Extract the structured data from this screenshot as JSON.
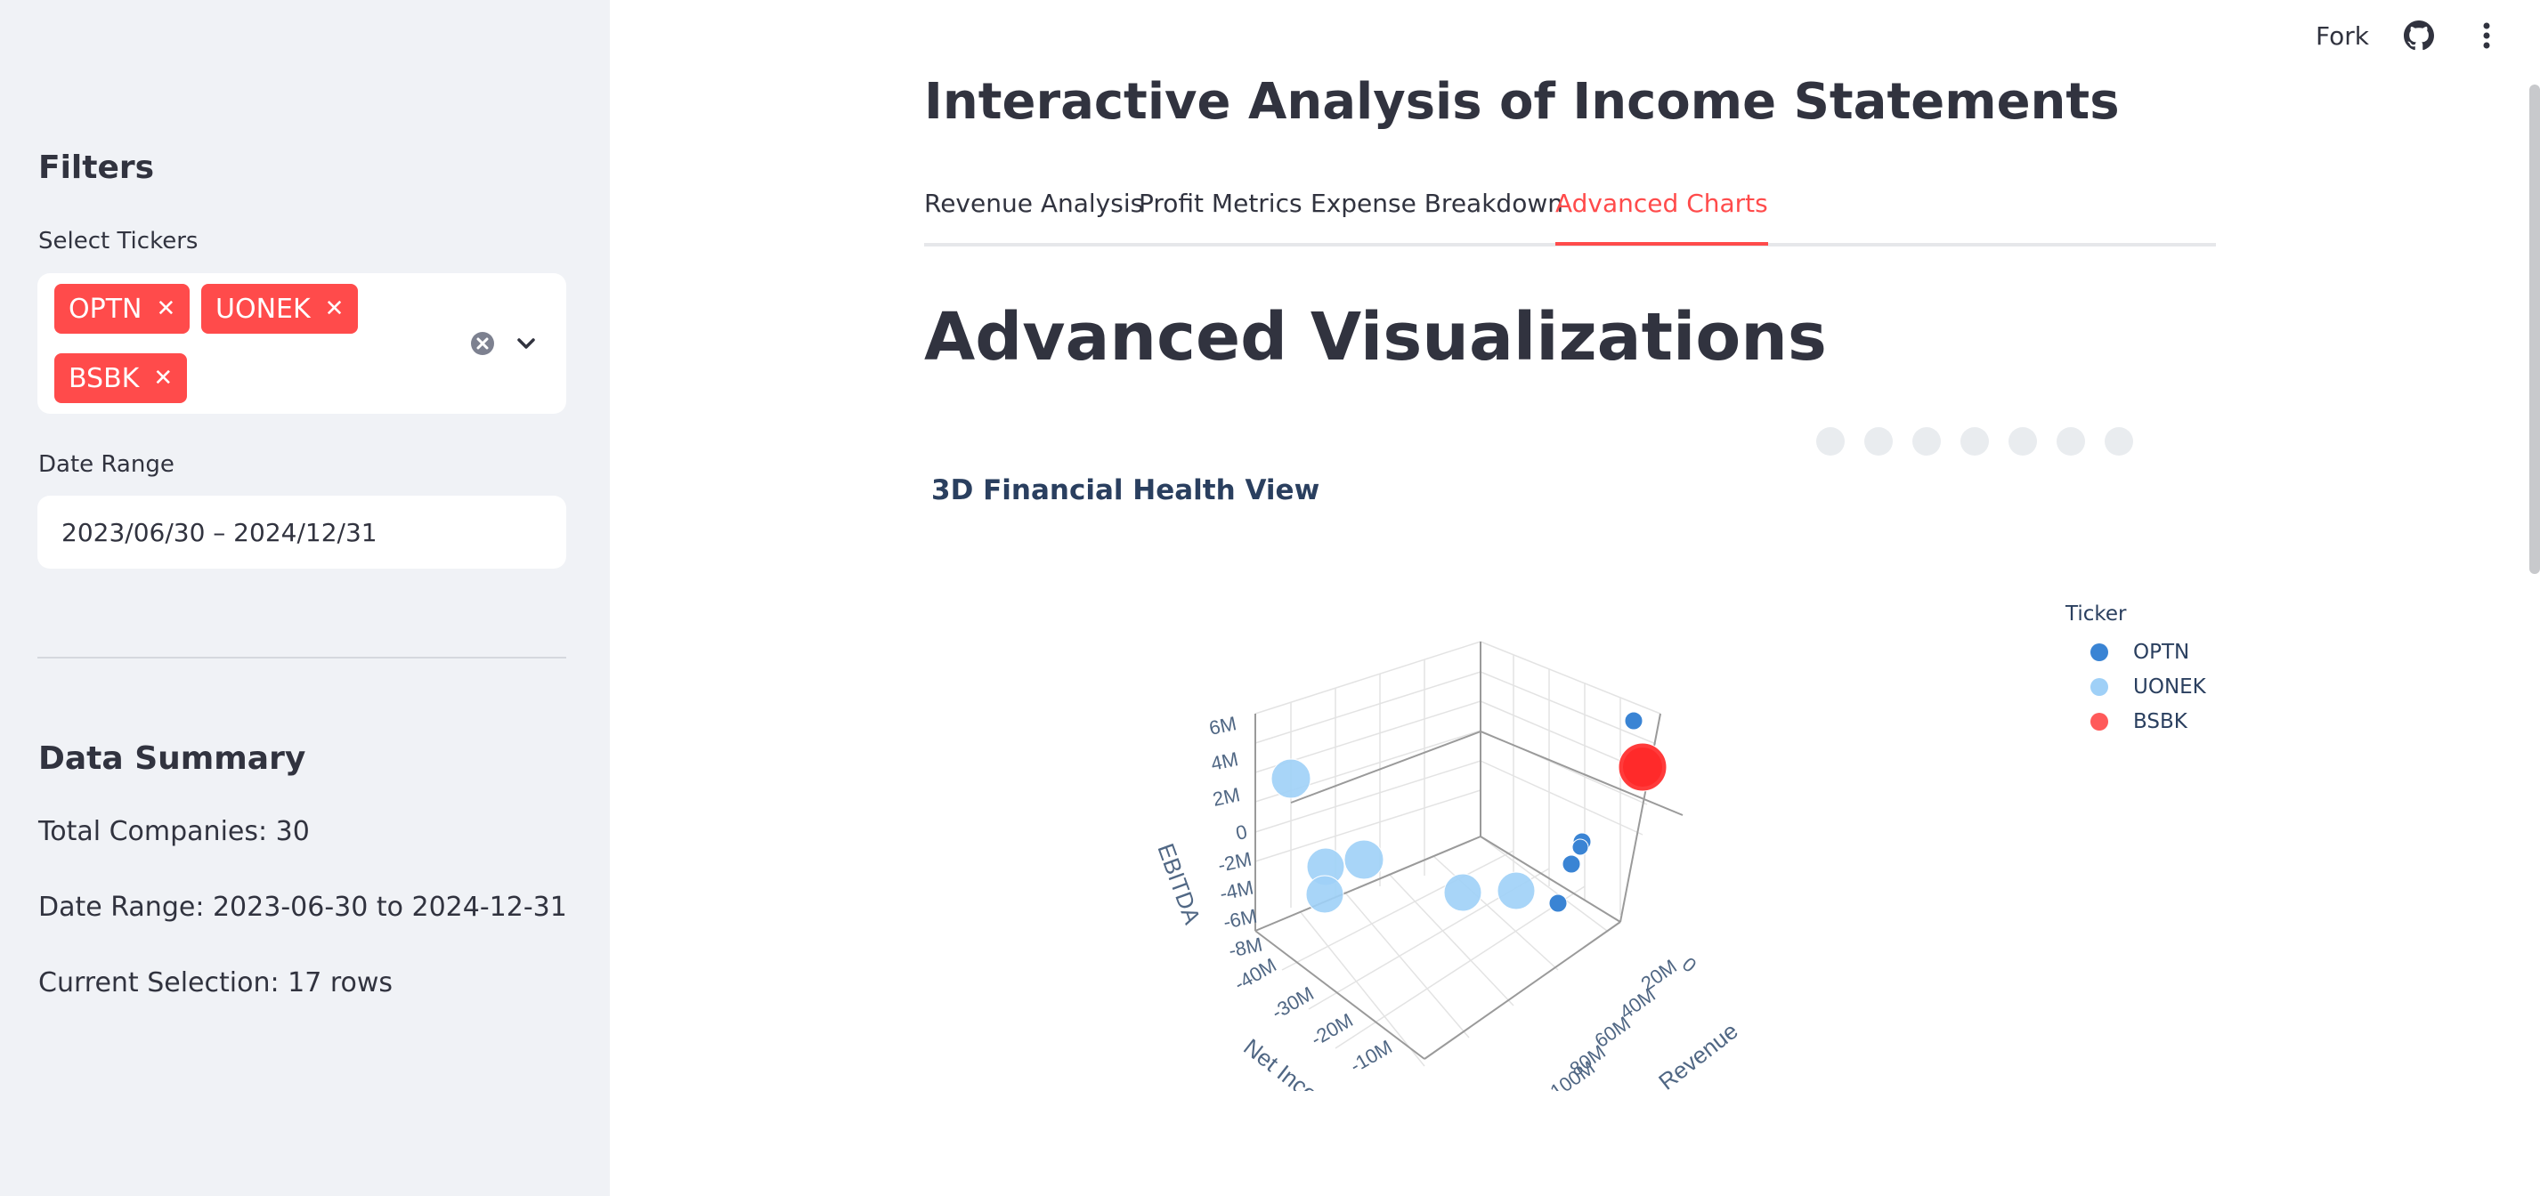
{
  "header": {
    "fork_label": "Fork",
    "icons": [
      "github-icon",
      "more-vertical-icon"
    ]
  },
  "sidebar": {
    "filters_title": "Filters",
    "tickers_label": "Select Tickers",
    "selected_tickers": [
      "OPTN",
      "UONEK",
      "BSBK"
    ],
    "date_label": "Date Range",
    "date_value": "2023/06/30 – 2024/12/31",
    "summary_title": "Data Summary",
    "summary_lines": [
      "Total Companies: 30",
      "Date Range: 2023-06-30 to 2024-12-31",
      "Current Selection: 17 rows"
    ]
  },
  "main": {
    "title": "Interactive Analysis of Income Statements",
    "tabs": [
      "Revenue Analysis",
      "Profit Metrics",
      "Expense Breakdown",
      "Advanced Charts"
    ],
    "active_tab": 3,
    "section_title": "Advanced Visualizations"
  },
  "chart_data": {
    "type": "scatter3d",
    "title": "3D Financial Health View",
    "legend_title": "Ticker",
    "axes": {
      "x": {
        "label": "Revenue",
        "ticks": [
          "0",
          "20M",
          "40M",
          "60M",
          "80M",
          "100M"
        ]
      },
      "y": {
        "label": "Net Income",
        "ticks": [
          "-40M",
          "-30M",
          "-20M",
          "-10M"
        ]
      },
      "z": {
        "label": "EBITDA",
        "ticks": [
          "6M",
          "4M",
          "2M",
          "0",
          "-2M",
          "-4M",
          "-6M",
          "-8M"
        ]
      }
    },
    "series": [
      {
        "name": "OPTN",
        "color": "#3a84d4"
      },
      {
        "name": "UONEK",
        "color": "#9fd0f7"
      },
      {
        "name": "BSBK",
        "color": "#ff3b3b"
      }
    ]
  },
  "colors": {
    "accent": "#ff4b4b",
    "text": "#31333f",
    "sidebar_bg": "#f0f2f6",
    "plot_text": "#2a3f5f"
  }
}
